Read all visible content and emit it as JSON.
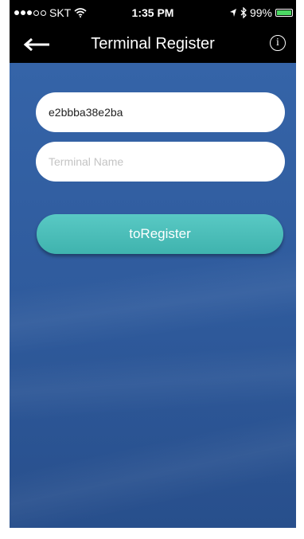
{
  "status_bar": {
    "carrier": "SKT",
    "time": "1:35 PM",
    "battery": "99%",
    "battery_level": 0.99,
    "icons": [
      "signal-dots-icon",
      "wifi-icon",
      "location-arrow-icon",
      "bluetooth-icon",
      "battery-icon"
    ]
  },
  "nav": {
    "back_icon": "arrow-left-icon",
    "title": "Terminal Register",
    "info_icon": "info-icon",
    "info_glyph": "i"
  },
  "form": {
    "terminal_id_value": "e2bbba38e2ba",
    "terminal_name_placeholder": "Terminal Name",
    "register_label": "toRegister"
  },
  "colors": {
    "background": "#2f5c9e",
    "button": "#4cbfba",
    "bar": "#000000"
  }
}
